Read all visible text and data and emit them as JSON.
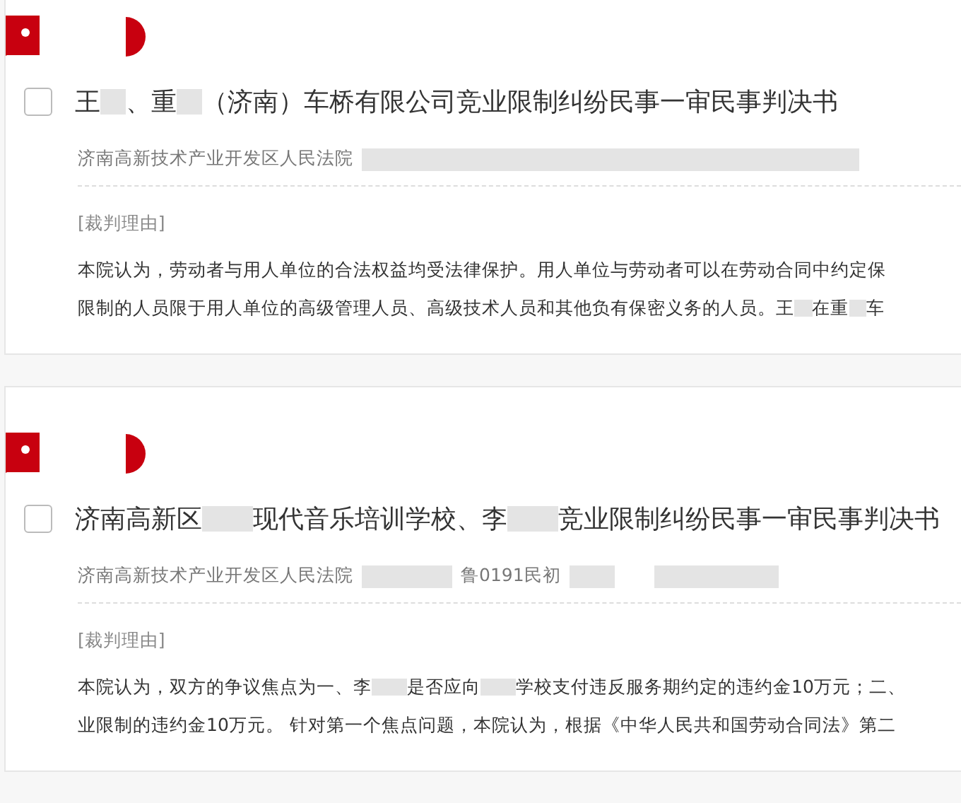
{
  "cases": [
    {
      "checked": false,
      "title": [
        {
          "kind": "text",
          "text": "王"
        },
        {
          "kind": "blur_char"
        },
        {
          "kind": "text",
          "text": "、重"
        },
        {
          "kind": "blur_char"
        },
        {
          "kind": "text",
          "text": "（济南）车桥有限公司竞业限制纠纷民事一审民事判决书"
        }
      ],
      "meta": [
        {
          "kind": "text",
          "text": "济南高新技术产业开发区人民法院"
        },
        {
          "kind": "blur_line"
        }
      ],
      "section_label": "[裁判理由]",
      "lines": [
        [
          {
            "kind": "text",
            "text": "本院认为，劳动者与用人单位的合法权益均受法律保护。用人单位与劳动者可以在劳动合同中约定保"
          }
        ],
        [
          {
            "kind": "text",
            "text": "限制的人员限于用人单位的高级管理人员、高级技术人员和其他负有保密义务的人员。王"
          },
          {
            "kind": "blur_char"
          },
          {
            "kind": "text",
            "text": "在重"
          },
          {
            "kind": "blur_char"
          },
          {
            "kind": "text",
            "text": "车"
          }
        ]
      ]
    },
    {
      "checked": false,
      "title": [
        {
          "kind": "text",
          "text": "济南高新区"
        },
        {
          "kind": "blur_word"
        },
        {
          "kind": "text",
          "text": "现代音乐培训学校、李"
        },
        {
          "kind": "blur_word"
        },
        {
          "kind": "text",
          "text": "竞业限制纠纷民事一审民事判决书"
        }
      ],
      "meta": [
        {
          "kind": "text",
          "text": "济南高新技术产业开发区人民法院"
        },
        {
          "kind": "blur_id"
        },
        {
          "kind": "text",
          "text": "鲁0191民初"
        },
        {
          "kind": "blur_word"
        },
        {
          "kind": "gap"
        },
        {
          "kind": "blur_field"
        }
      ],
      "section_label": "[裁判理由]",
      "lines": [
        [
          {
            "kind": "text",
            "text": "本院认为，双方的争议焦点为一、李"
          },
          {
            "kind": "blur_word"
          },
          {
            "kind": "text",
            "text": "是否应向"
          },
          {
            "kind": "blur_word"
          },
          {
            "kind": "text",
            "text": "学校支付违反服务期约定的违约金10万元；二、"
          }
        ],
        [
          {
            "kind": "text",
            "text": "业限制的违约金10万元。 针对第一个焦点问题，本院认为，根据《中华人民共和国劳动合同法》第二"
          }
        ]
      ]
    }
  ]
}
